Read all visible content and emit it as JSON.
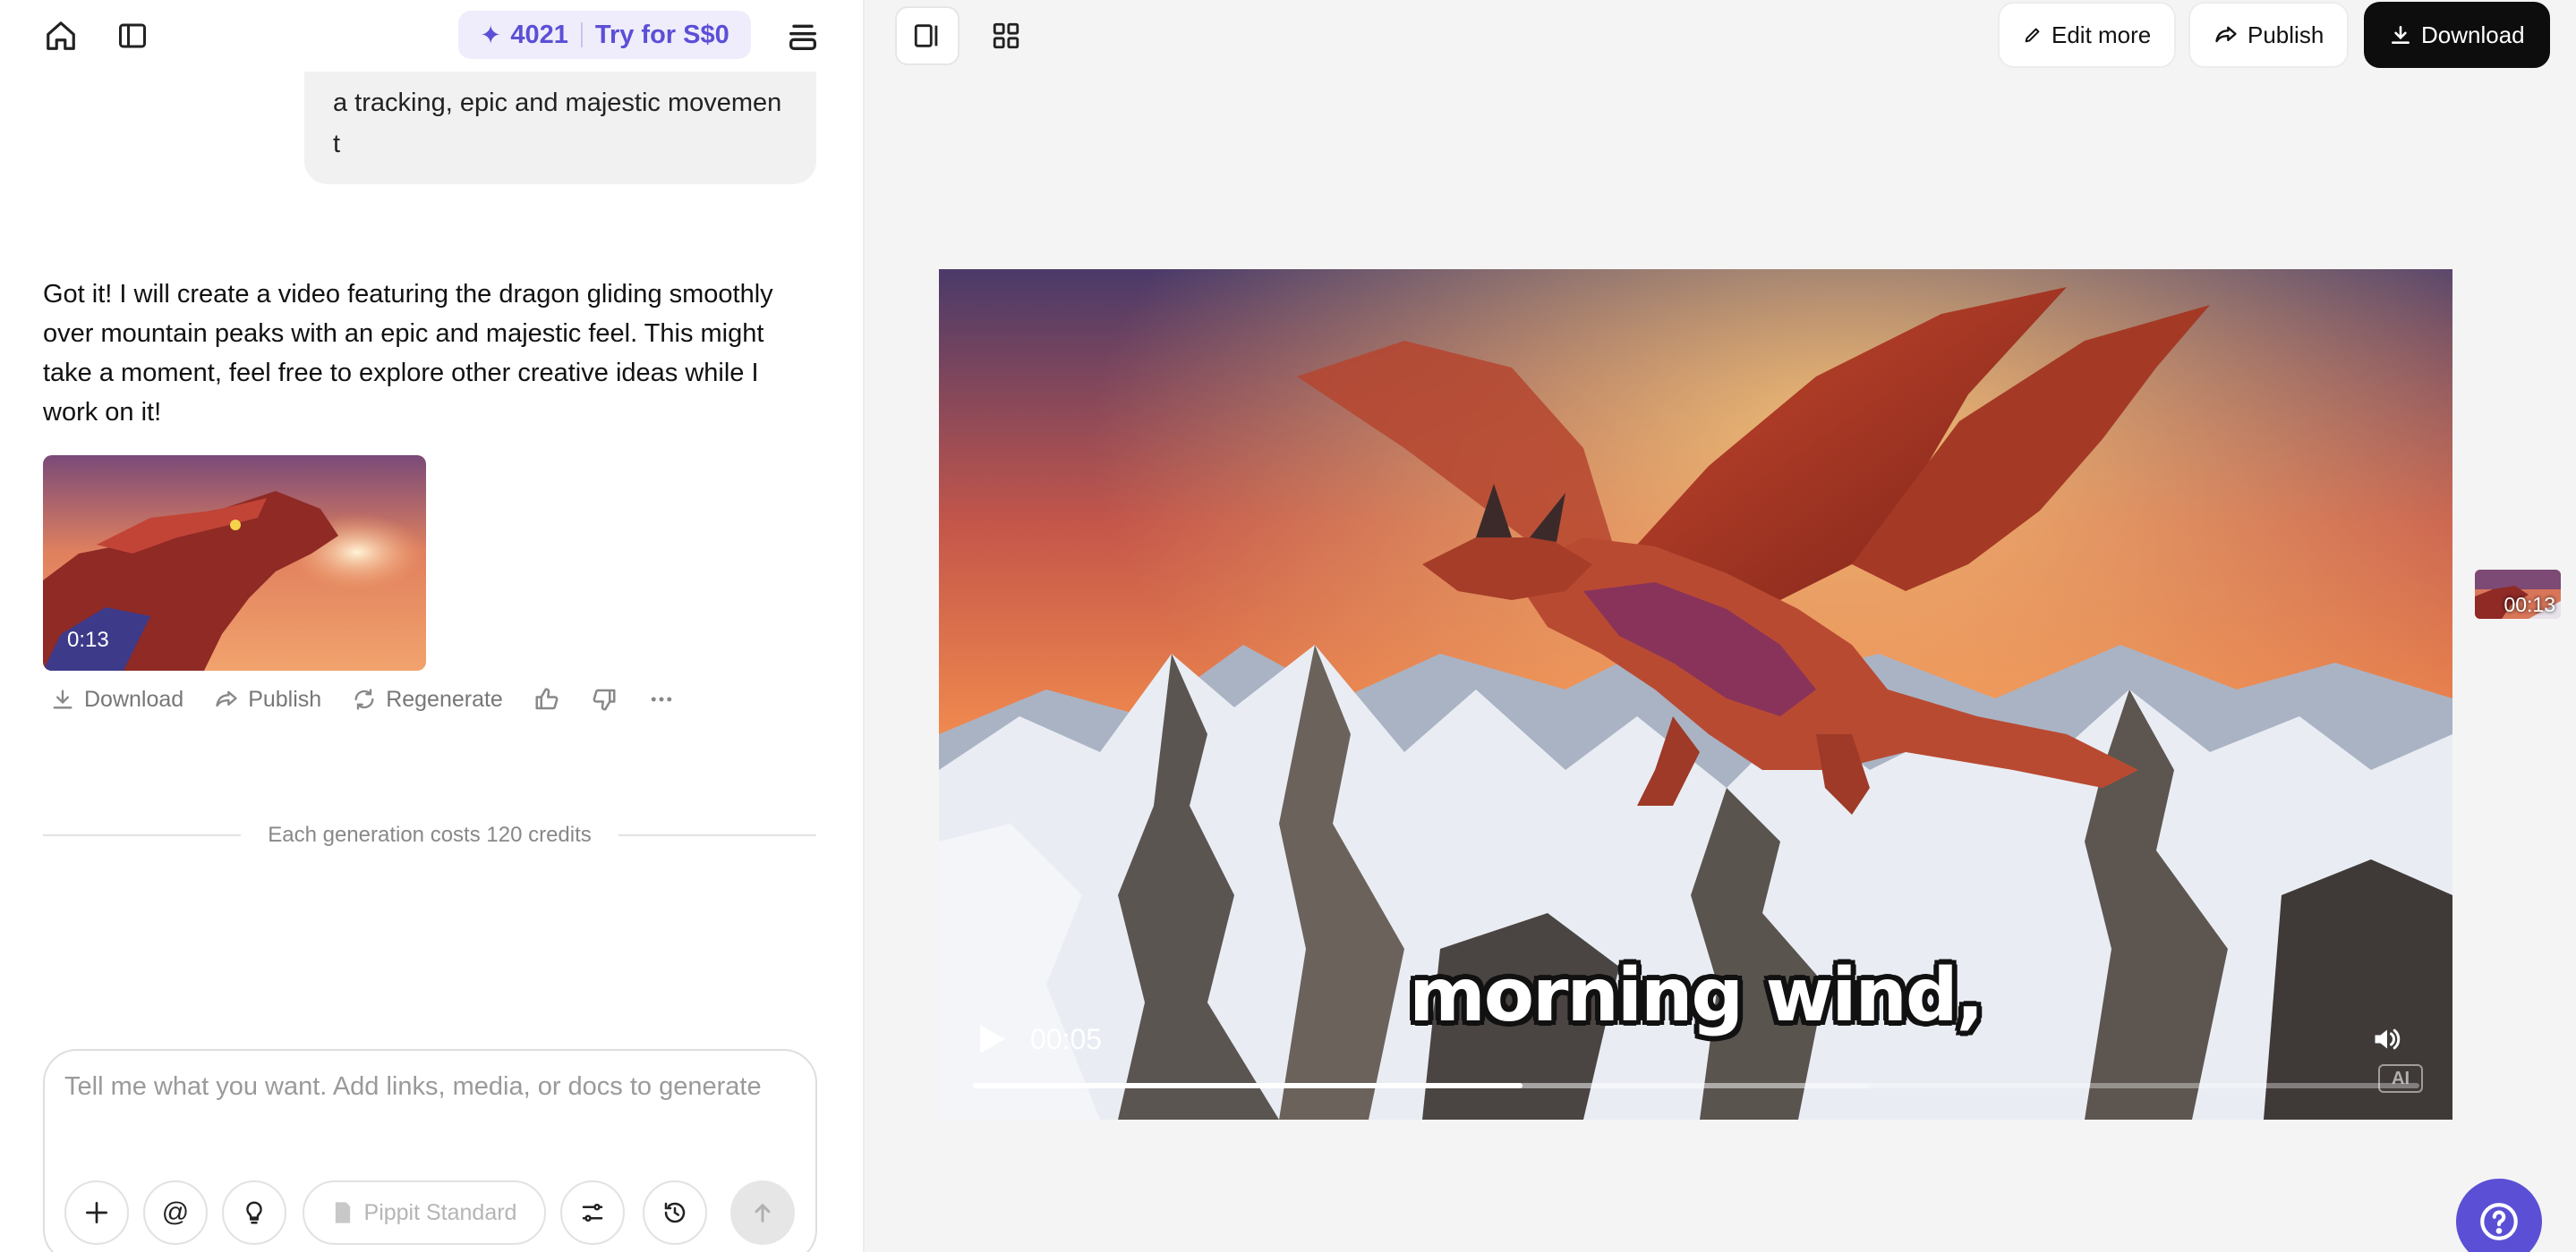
{
  "left_panel": {
    "credits": {
      "count": "4021",
      "try_label": "Try for S$0"
    },
    "user_message_tail": [
      "a tracking, epic and majestic movemen",
      "t"
    ],
    "assistant_message": "Got it! I will create a video featuring the dragon gliding smoothly over mountain peaks with an epic and majestic feel. This might take a moment, feel free to explore other creative ideas while I work on it!",
    "thumbnail_duration": "0:13",
    "actions": {
      "download": "Download",
      "publish": "Publish",
      "regenerate": "Regenerate"
    },
    "cost_note": "Each generation costs 120 credits",
    "composer": {
      "placeholder": "Tell me what you want. Add links, media, or docs to generate",
      "model": "Pippit Standard"
    }
  },
  "right_panel": {
    "buttons": {
      "edit_more": "Edit more",
      "publish": "Publish",
      "download": "Download"
    },
    "video": {
      "caption": "morning wind,",
      "current_time": "00:05",
      "progress": 0.38,
      "buffered": 0.62,
      "ai_badge": "AI"
    },
    "side_thumb_duration": "00:13"
  },
  "colors": {
    "accent": "#5b4fd6",
    "download_bg": "#0d0d0d"
  },
  "icons": [
    "home-icon",
    "sidebar-toggle-icon",
    "sparkle-icon",
    "menu-stack-icon",
    "download-icon",
    "share-icon",
    "regenerate-icon",
    "thumbs-up-icon",
    "thumbs-down-icon",
    "more-icon",
    "plus-icon",
    "at-icon",
    "lightbulb-icon",
    "model-icon",
    "settings-sliders-icon",
    "history-icon",
    "send-arrow-icon",
    "split-view-icon",
    "grid-icon",
    "pencil-icon",
    "chevron-right-icon",
    "play-icon",
    "volume-icon",
    "help-icon"
  ]
}
